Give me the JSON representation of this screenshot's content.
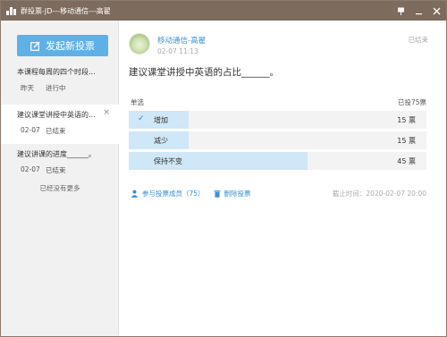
{
  "window": {
    "title": "群投票-JD---移动通信---高翟"
  },
  "sidebar": {
    "new_button": "发起新投票",
    "items": [
      {
        "title": "本课程每周的四个时段...",
        "date": "昨天",
        "status": "进行中"
      },
      {
        "title": "建议课堂讲授中英语的...",
        "date": "02-07",
        "status": "已结束"
      },
      {
        "title": "建议讲课的进度______。",
        "date": "02-07",
        "status": "已结束"
      }
    ],
    "no_more": "已经没有更多"
  },
  "vote": {
    "author": "移动通信-高翟",
    "time": "02-07 11:13",
    "status": "已结束",
    "question": "建议课堂讲授中英语的占比______。",
    "mode": "单选",
    "voted": "已投75票",
    "options": [
      {
        "label": "增加",
        "count": "15 票",
        "fraction": 0.2,
        "selected": true
      },
      {
        "label": "减少",
        "count": "15 票",
        "fraction": 0.2,
        "selected": false
      },
      {
        "label": "保持不变",
        "count": "45 票",
        "fraction": 0.6,
        "selected": false
      }
    ],
    "participants": "参与投票成员（75）",
    "delete": "删除投票",
    "deadline": "截止时间：2020-02-07 20:00"
  },
  "icons": {
    "app": "bar-chart-icon",
    "pin": "pin-icon",
    "minimize": "minimize-icon",
    "close": "close-icon",
    "edit": "edit-icon",
    "check": "check-icon",
    "users": "users-icon",
    "trash": "trash-icon"
  },
  "colors": {
    "titlebar": "#7d6b5d",
    "accent": "#5fb0e6",
    "link": "#3b8fd4",
    "bar_fill": "#cfe7f7"
  }
}
